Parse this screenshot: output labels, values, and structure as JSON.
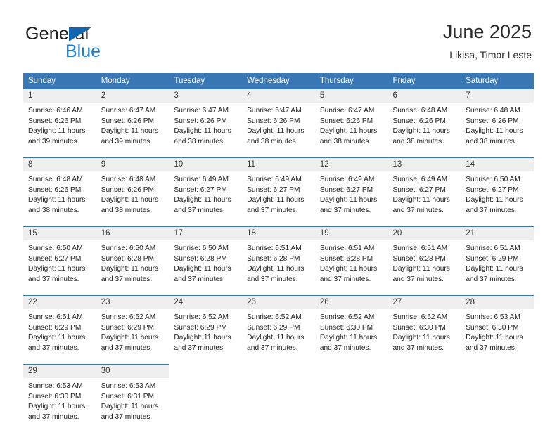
{
  "brand": {
    "word_one": "General",
    "word_two": "Blue",
    "triangle_icon": "triangle-icon",
    "accent_dark_blue": "#1267b2",
    "accent_light_blue": "#1b7fd4"
  },
  "header": {
    "title": "June 2025",
    "subtitle": "Likisa, Timor Leste"
  },
  "theme": {
    "header_row_bg": "#3a77b5",
    "header_row_text": "#ffffff",
    "daynum_bg": "#efefef",
    "cell_bg": "#ffffff",
    "text": "#222222"
  },
  "calendar": {
    "weekday_headers": [
      "Sunday",
      "Monday",
      "Tuesday",
      "Wednesday",
      "Thursday",
      "Friday",
      "Saturday"
    ],
    "weeks": [
      [
        {
          "day": "1",
          "sunrise": "Sunrise: 6:46 AM",
          "sunset": "Sunset: 6:26 PM",
          "daylight_1": "Daylight: 11 hours",
          "daylight_2": "and 39 minutes."
        },
        {
          "day": "2",
          "sunrise": "Sunrise: 6:47 AM",
          "sunset": "Sunset: 6:26 PM",
          "daylight_1": "Daylight: 11 hours",
          "daylight_2": "and 39 minutes."
        },
        {
          "day": "3",
          "sunrise": "Sunrise: 6:47 AM",
          "sunset": "Sunset: 6:26 PM",
          "daylight_1": "Daylight: 11 hours",
          "daylight_2": "and 38 minutes."
        },
        {
          "day": "4",
          "sunrise": "Sunrise: 6:47 AM",
          "sunset": "Sunset: 6:26 PM",
          "daylight_1": "Daylight: 11 hours",
          "daylight_2": "and 38 minutes."
        },
        {
          "day": "5",
          "sunrise": "Sunrise: 6:47 AM",
          "sunset": "Sunset: 6:26 PM",
          "daylight_1": "Daylight: 11 hours",
          "daylight_2": "and 38 minutes."
        },
        {
          "day": "6",
          "sunrise": "Sunrise: 6:48 AM",
          "sunset": "Sunset: 6:26 PM",
          "daylight_1": "Daylight: 11 hours",
          "daylight_2": "and 38 minutes."
        },
        {
          "day": "7",
          "sunrise": "Sunrise: 6:48 AM",
          "sunset": "Sunset: 6:26 PM",
          "daylight_1": "Daylight: 11 hours",
          "daylight_2": "and 38 minutes."
        }
      ],
      [
        {
          "day": "8",
          "sunrise": "Sunrise: 6:48 AM",
          "sunset": "Sunset: 6:26 PM",
          "daylight_1": "Daylight: 11 hours",
          "daylight_2": "and 38 minutes."
        },
        {
          "day": "9",
          "sunrise": "Sunrise: 6:48 AM",
          "sunset": "Sunset: 6:26 PM",
          "daylight_1": "Daylight: 11 hours",
          "daylight_2": "and 38 minutes."
        },
        {
          "day": "10",
          "sunrise": "Sunrise: 6:49 AM",
          "sunset": "Sunset: 6:27 PM",
          "daylight_1": "Daylight: 11 hours",
          "daylight_2": "and 37 minutes."
        },
        {
          "day": "11",
          "sunrise": "Sunrise: 6:49 AM",
          "sunset": "Sunset: 6:27 PM",
          "daylight_1": "Daylight: 11 hours",
          "daylight_2": "and 37 minutes."
        },
        {
          "day": "12",
          "sunrise": "Sunrise: 6:49 AM",
          "sunset": "Sunset: 6:27 PM",
          "daylight_1": "Daylight: 11 hours",
          "daylight_2": "and 37 minutes."
        },
        {
          "day": "13",
          "sunrise": "Sunrise: 6:49 AM",
          "sunset": "Sunset: 6:27 PM",
          "daylight_1": "Daylight: 11 hours",
          "daylight_2": "and 37 minutes."
        },
        {
          "day": "14",
          "sunrise": "Sunrise: 6:50 AM",
          "sunset": "Sunset: 6:27 PM",
          "daylight_1": "Daylight: 11 hours",
          "daylight_2": "and 37 minutes."
        }
      ],
      [
        {
          "day": "15",
          "sunrise": "Sunrise: 6:50 AM",
          "sunset": "Sunset: 6:27 PM",
          "daylight_1": "Daylight: 11 hours",
          "daylight_2": "and 37 minutes."
        },
        {
          "day": "16",
          "sunrise": "Sunrise: 6:50 AM",
          "sunset": "Sunset: 6:28 PM",
          "daylight_1": "Daylight: 11 hours",
          "daylight_2": "and 37 minutes."
        },
        {
          "day": "17",
          "sunrise": "Sunrise: 6:50 AM",
          "sunset": "Sunset: 6:28 PM",
          "daylight_1": "Daylight: 11 hours",
          "daylight_2": "and 37 minutes."
        },
        {
          "day": "18",
          "sunrise": "Sunrise: 6:51 AM",
          "sunset": "Sunset: 6:28 PM",
          "daylight_1": "Daylight: 11 hours",
          "daylight_2": "and 37 minutes."
        },
        {
          "day": "19",
          "sunrise": "Sunrise: 6:51 AM",
          "sunset": "Sunset: 6:28 PM",
          "daylight_1": "Daylight: 11 hours",
          "daylight_2": "and 37 minutes."
        },
        {
          "day": "20",
          "sunrise": "Sunrise: 6:51 AM",
          "sunset": "Sunset: 6:28 PM",
          "daylight_1": "Daylight: 11 hours",
          "daylight_2": "and 37 minutes."
        },
        {
          "day": "21",
          "sunrise": "Sunrise: 6:51 AM",
          "sunset": "Sunset: 6:29 PM",
          "daylight_1": "Daylight: 11 hours",
          "daylight_2": "and 37 minutes."
        }
      ],
      [
        {
          "day": "22",
          "sunrise": "Sunrise: 6:51 AM",
          "sunset": "Sunset: 6:29 PM",
          "daylight_1": "Daylight: 11 hours",
          "daylight_2": "and 37 minutes."
        },
        {
          "day": "23",
          "sunrise": "Sunrise: 6:52 AM",
          "sunset": "Sunset: 6:29 PM",
          "daylight_1": "Daylight: 11 hours",
          "daylight_2": "and 37 minutes."
        },
        {
          "day": "24",
          "sunrise": "Sunrise: 6:52 AM",
          "sunset": "Sunset: 6:29 PM",
          "daylight_1": "Daylight: 11 hours",
          "daylight_2": "and 37 minutes."
        },
        {
          "day": "25",
          "sunrise": "Sunrise: 6:52 AM",
          "sunset": "Sunset: 6:29 PM",
          "daylight_1": "Daylight: 11 hours",
          "daylight_2": "and 37 minutes."
        },
        {
          "day": "26",
          "sunrise": "Sunrise: 6:52 AM",
          "sunset": "Sunset: 6:30 PM",
          "daylight_1": "Daylight: 11 hours",
          "daylight_2": "and 37 minutes."
        },
        {
          "day": "27",
          "sunrise": "Sunrise: 6:52 AM",
          "sunset": "Sunset: 6:30 PM",
          "daylight_1": "Daylight: 11 hours",
          "daylight_2": "and 37 minutes."
        },
        {
          "day": "28",
          "sunrise": "Sunrise: 6:53 AM",
          "sunset": "Sunset: 6:30 PM",
          "daylight_1": "Daylight: 11 hours",
          "daylight_2": "and 37 minutes."
        }
      ],
      [
        {
          "day": "29",
          "sunrise": "Sunrise: 6:53 AM",
          "sunset": "Sunset: 6:30 PM",
          "daylight_1": "Daylight: 11 hours",
          "daylight_2": "and 37 minutes."
        },
        {
          "day": "30",
          "sunrise": "Sunrise: 6:53 AM",
          "sunset": "Sunset: 6:31 PM",
          "daylight_1": "Daylight: 11 hours",
          "daylight_2": "and 37 minutes."
        },
        {
          "day": "",
          "sunrise": "",
          "sunset": "",
          "daylight_1": "",
          "daylight_2": ""
        },
        {
          "day": "",
          "sunrise": "",
          "sunset": "",
          "daylight_1": "",
          "daylight_2": ""
        },
        {
          "day": "",
          "sunrise": "",
          "sunset": "",
          "daylight_1": "",
          "daylight_2": ""
        },
        {
          "day": "",
          "sunrise": "",
          "sunset": "",
          "daylight_1": "",
          "daylight_2": ""
        },
        {
          "day": "",
          "sunrise": "",
          "sunset": "",
          "daylight_1": "",
          "daylight_2": ""
        }
      ]
    ]
  }
}
